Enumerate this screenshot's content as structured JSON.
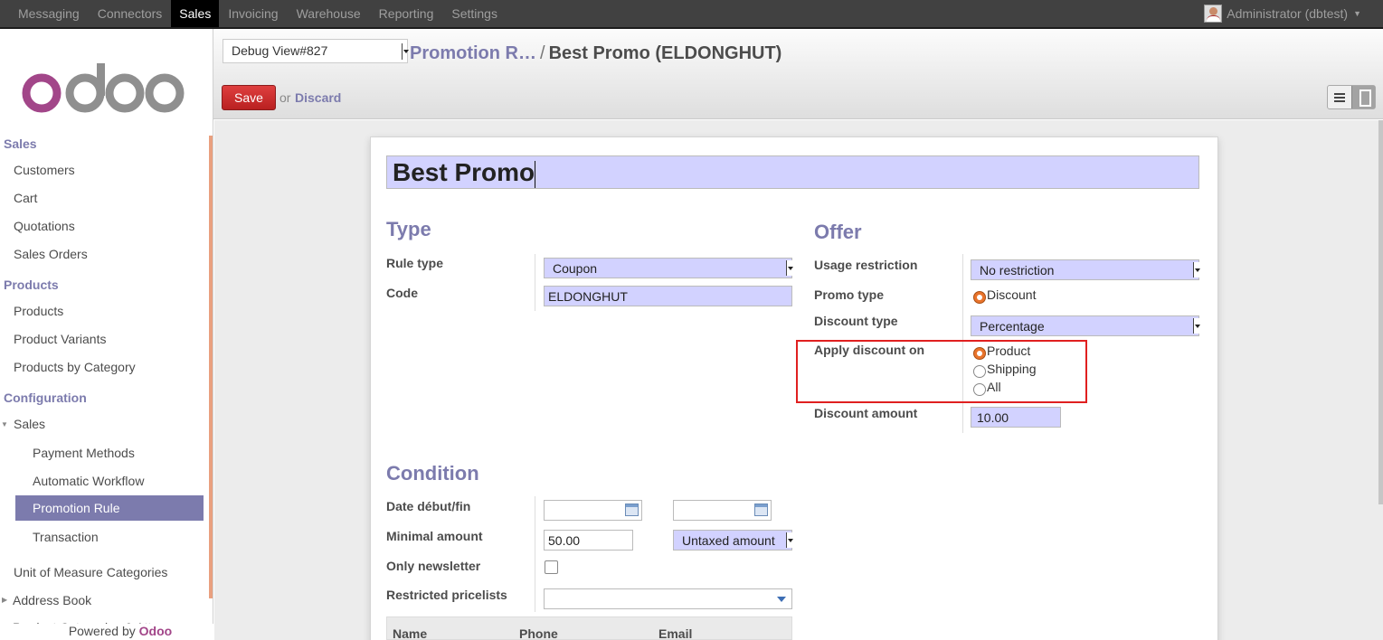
{
  "topbar": {
    "menu": [
      "Messaging",
      "Connectors",
      "Sales",
      "Invoicing",
      "Warehouse",
      "Reporting",
      "Settings"
    ],
    "active": "Sales",
    "user": "Administrator (dbtest)"
  },
  "logo": "odoo",
  "sidebar": {
    "sections": [
      {
        "title": "Sales",
        "items": [
          "Customers",
          "Cart",
          "Quotations",
          "Sales Orders"
        ]
      },
      {
        "title": "Products",
        "items": [
          "Products",
          "Product Variants",
          "Products by Category"
        ]
      },
      {
        "title": "Configuration",
        "group": "Sales",
        "items": [
          "Payment Methods",
          "Automatic Workflow",
          "Promotion Rule",
          "Transaction"
        ],
        "after": [
          "Unit of Measure Categories",
          "Address Book",
          "Product Categories & Att..."
        ]
      }
    ],
    "powered_prefix": "Powered by",
    "powered_brand": "Odoo"
  },
  "control": {
    "debug": "Debug View#827",
    "breadcrumb_parent": "Promotion R…",
    "breadcrumb_sep": "/",
    "breadcrumb_current": "Best Promo (ELDONGHUT)",
    "save": "Save",
    "or": "or",
    "discard": "Discard"
  },
  "form": {
    "name": "Best Promo",
    "type_group": {
      "title": "Type",
      "rule_type_label": "Rule type",
      "rule_type_value": "Coupon",
      "code_label": "Code",
      "code_value": "ELDONGHUT"
    },
    "offer_group": {
      "title": "Offer",
      "usage_label": "Usage restriction",
      "usage_value": "No restriction",
      "promo_type_label": "Promo type",
      "promo_type_option": "Discount",
      "discount_type_label": "Discount type",
      "discount_type_value": "Percentage",
      "apply_label": "Apply discount on",
      "apply_options": [
        "Product",
        "Shipping",
        "All"
      ],
      "apply_selected": "Product",
      "amount_label": "Discount amount",
      "amount_value": "10.00"
    },
    "condition_group": {
      "title": "Condition",
      "date_label": "Date début/fin",
      "min_amount_label": "Minimal amount",
      "min_amount_value": "50.00",
      "tax_mode_value": "Untaxed amount",
      "newsletter_label": "Only newsletter",
      "newsletter_checked": false,
      "pricelists_label": "Restricted pricelists",
      "table_headers": [
        "Name",
        "Phone",
        "Email"
      ]
    }
  },
  "colors": {
    "accent": "#7c7bad",
    "required_field": "#d2d2ff",
    "save_button": "#c52828",
    "highlight_box": "#e02020"
  }
}
